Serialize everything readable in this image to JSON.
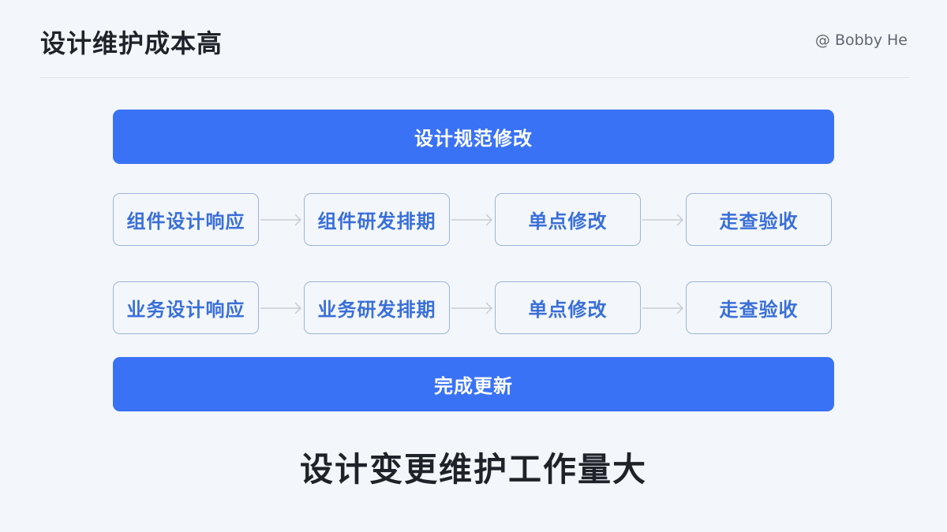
{
  "header": {
    "title": "设计维护成本高",
    "author": "@ Bobby He"
  },
  "diagram": {
    "top_bar": "设计规范修改",
    "rows": [
      {
        "steps": [
          "组件设计响应",
          "组件研发排期",
          "单点修改",
          "走查验收"
        ]
      },
      {
        "steps": [
          "业务设计响应",
          "业务研发排期",
          "单点修改",
          "走查验收"
        ]
      }
    ],
    "bottom_bar": "完成更新"
  },
  "conclusion": "设计变更维护工作量大",
  "colors": {
    "accent": "#3a72f6",
    "box_text": "#3a6fd8",
    "box_border": "#9db3d6",
    "background": "#f3f7fb",
    "arrow": "#c7cdd4"
  }
}
